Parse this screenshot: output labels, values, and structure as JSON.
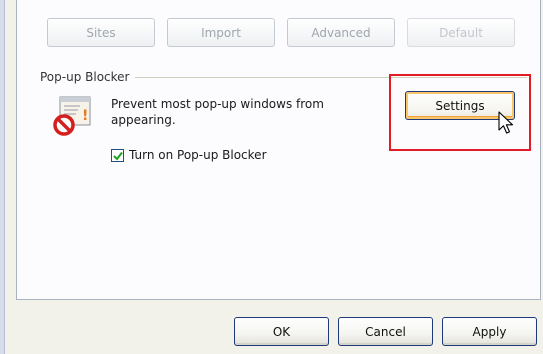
{
  "top_buttons": [
    {
      "label": "Sites"
    },
    {
      "label": "Import"
    },
    {
      "label": "Advanced"
    },
    {
      "label": "Default"
    }
  ],
  "popup_blocker": {
    "group_label": "Pop-up Blocker",
    "description": "Prevent most pop-up windows from appearing.",
    "settings_label": "Settings",
    "checkbox_label": "Turn on Pop-up Blocker",
    "checkbox_checked": true
  },
  "footer": {
    "ok_label": "OK",
    "cancel_label": "Cancel",
    "apply_label": "Apply"
  },
  "icons": {
    "blocker": "popup-blocker-icon",
    "cursor": "mouse-pointer-icon"
  },
  "colors": {
    "highlight": "#e21b24",
    "hover_accent": "#f8c56a"
  }
}
